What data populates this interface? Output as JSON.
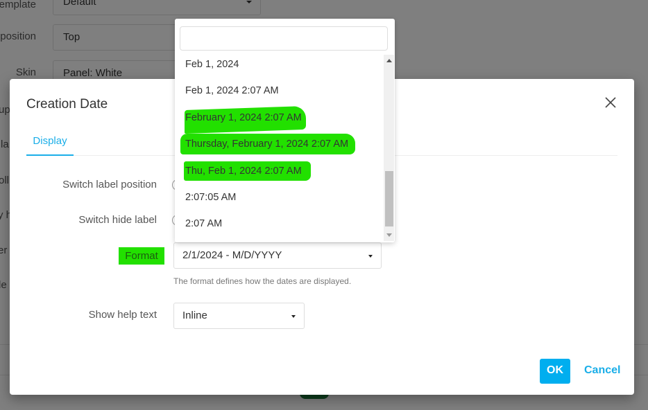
{
  "background": {
    "rows": [
      {
        "label": "emplate",
        "value": "Default",
        "has_caret": true
      },
      {
        "label": "position",
        "value": "Top",
        "has_caret": false
      },
      {
        "label": "Skin",
        "value": "Panel: White",
        "has_caret": false
      }
    ],
    "side_fragments": [
      "up",
      "la",
      "oll",
      "y h",
      "er",
      "le"
    ]
  },
  "modal": {
    "title": "Creation Date",
    "close_icon": "close-icon",
    "tabs": [
      {
        "label": "Display",
        "active": true
      }
    ],
    "fields": {
      "switch_label_position": {
        "label": "Switch label position"
      },
      "switch_hide_label": {
        "label": "Switch hide label"
      },
      "format": {
        "label": "Format",
        "value": "2/1/2024 - M/D/YYYY",
        "help": "The format defines how the dates are displayed.",
        "highlighted": true
      },
      "show_help_text": {
        "label": "Show help text",
        "value": "Inline"
      }
    },
    "ok_label": "OK",
    "cancel_label": "Cancel"
  },
  "dropdown": {
    "search_value": "",
    "options": [
      {
        "label": "Feb 1, 2024",
        "highlighted": false
      },
      {
        "label": "Feb 1, 2024 2:07 AM",
        "highlighted": false
      },
      {
        "label": "February 1, 2024 2:07 AM",
        "highlighted": true
      },
      {
        "label": "Thursday, February 1, 2024 2:07 AM",
        "highlighted": true
      },
      {
        "label": "Thu, Feb 1, 2024 2:07 AM",
        "highlighted": true
      },
      {
        "label": "2:07:05 AM",
        "highlighted": false
      },
      {
        "label": "2:07 AM",
        "highlighted": false
      }
    ],
    "scroll_position": 0.85
  },
  "colors": {
    "accent": "#00aeef",
    "highlight": "#22e000",
    "overlay": "#808080"
  }
}
